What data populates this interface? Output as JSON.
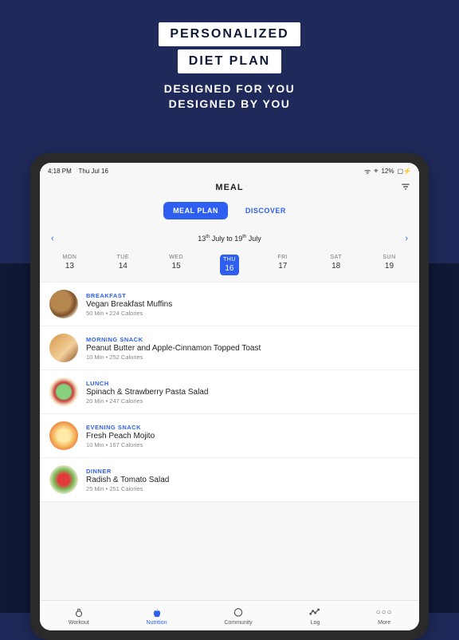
{
  "hero": {
    "line1": "PERSONALIZED",
    "line2": "DIET PLAN",
    "sub1": "DESIGNED FOR YOU",
    "sub2": "DESIGNED BY YOU"
  },
  "status": {
    "time": "4:18 PM",
    "date": "Thu Jul 16",
    "battery": "12%"
  },
  "nav": {
    "title": "MEAL"
  },
  "tabs": {
    "mealplan": "MEAL PLAN",
    "discover": "DISCOVER",
    "active": "mealplan"
  },
  "week": {
    "range_a": "13",
    "range_a_sup": "th",
    "range_mid": " July to ",
    "range_b": "19",
    "range_b_sup": "th",
    "range_end": " July"
  },
  "days": [
    {
      "dow": "MON",
      "n": "13",
      "active": false
    },
    {
      "dow": "TUE",
      "n": "14",
      "active": false
    },
    {
      "dow": "WED",
      "n": "15",
      "active": false
    },
    {
      "dow": "THU",
      "n": "16",
      "active": true
    },
    {
      "dow": "FRI",
      "n": "17",
      "active": false
    },
    {
      "dow": "SAT",
      "n": "18",
      "active": false
    },
    {
      "dow": "SUN",
      "n": "19",
      "active": false
    }
  ],
  "meals": [
    {
      "cat": "BREAKFAST",
      "title": "Vegan Breakfast Muffins",
      "meta": "50 Min • 224 Calories"
    },
    {
      "cat": "MORNING SNACK",
      "title": "Peanut Butter and Apple-Cinnamon Topped Toast",
      "meta": "10 Min • 252 Calories"
    },
    {
      "cat": "LUNCH",
      "title": "Spinach & Strawberry Pasta Salad",
      "meta": "20 Min • 247 Calories"
    },
    {
      "cat": "EVENING SNACK",
      "title": "Fresh Peach Mojito",
      "meta": "10 Min • 167 Calories"
    },
    {
      "cat": "DINNER",
      "title": "Radish & Tomato Salad",
      "meta": "25 Min • 251 Calories"
    }
  ],
  "bottom": {
    "workout": "Workout",
    "nutrition": "Nutrition",
    "community": "Community",
    "log": "Log",
    "more": "More",
    "active": "nutrition"
  }
}
